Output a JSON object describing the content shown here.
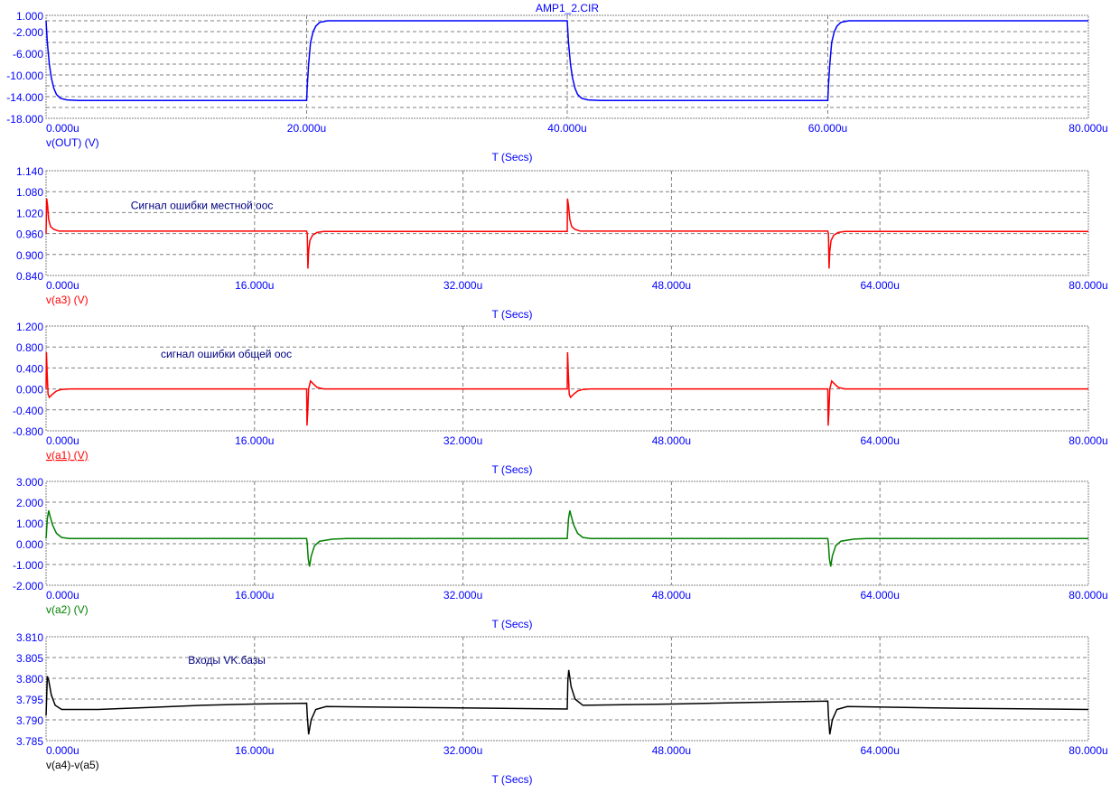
{
  "title": "AMP1_2.CIR",
  "title_color": "#0000ff",
  "axis_label_color": "#0000ff",
  "chart_data": [
    {
      "type": "line",
      "series_name": "v(OUT) (V)",
      "color": "#0000ff",
      "xlabel": "T (Secs)",
      "xlim": [
        0,
        80
      ],
      "x_ticks": [
        0,
        20,
        40,
        60,
        80
      ],
      "x_tick_labels": [
        "0.000u",
        "20.000u",
        "40.000u",
        "60.000u",
        "80.000u"
      ],
      "ylim": [
        -18,
        1
      ],
      "y_grid": [
        -16,
        -14,
        -12,
        -10,
        -8,
        -6,
        -4,
        -2,
        0
      ],
      "y_tick_values": [
        1,
        -2,
        -6,
        -10,
        -14,
        -18
      ],
      "y_tick_labels": [
        "1.000",
        "-2.000",
        "-6.000",
        "-10.000",
        "-14.000",
        "-18.000"
      ],
      "annotation": "",
      "points": [
        [
          0,
          0
        ],
        [
          0.1,
          -4
        ],
        [
          0.25,
          -8
        ],
        [
          0.4,
          -10.5
        ],
        [
          0.6,
          -12.5
        ],
        [
          0.8,
          -13.6
        ],
        [
          1.1,
          -14.3
        ],
        [
          1.6,
          -14.6
        ],
        [
          2.5,
          -14.7
        ],
        [
          20,
          -14.7
        ],
        [
          20.05,
          -12
        ],
        [
          20.15,
          -8
        ],
        [
          20.3,
          -4
        ],
        [
          20.5,
          -2
        ],
        [
          20.7,
          -1
        ],
        [
          21,
          -0.3
        ],
        [
          21.6,
          0
        ],
        [
          40,
          0
        ],
        [
          40.1,
          -4
        ],
        [
          40.25,
          -8
        ],
        [
          40.4,
          -10.5
        ],
        [
          40.6,
          -12.5
        ],
        [
          40.8,
          -13.6
        ],
        [
          41.1,
          -14.3
        ],
        [
          41.6,
          -14.6
        ],
        [
          42.5,
          -14.7
        ],
        [
          60,
          -14.7
        ],
        [
          60.05,
          -12
        ],
        [
          60.15,
          -8
        ],
        [
          60.3,
          -4
        ],
        [
          60.5,
          -2
        ],
        [
          60.7,
          -1
        ],
        [
          61,
          -0.3
        ],
        [
          61.6,
          0
        ],
        [
          80,
          0
        ]
      ]
    },
    {
      "type": "line",
      "series_name": "v(a3) (V)",
      "color": "#ff0000",
      "xlabel": "T (Secs)",
      "xlim": [
        0,
        80
      ],
      "x_ticks": [
        0,
        16,
        32,
        48,
        64,
        80
      ],
      "x_tick_labels": [
        "0.000u",
        "16.000u",
        "32.000u",
        "48.000u",
        "64.000u",
        "80.000u"
      ],
      "ylim": [
        0.84,
        1.14
      ],
      "y_grid": [
        0.9,
        0.96,
        1.02,
        1.08
      ],
      "y_tick_values": [
        1.14,
        1.08,
        1.02,
        0.96,
        0.9,
        0.84
      ],
      "y_tick_labels": [
        "1.140",
        "1.080",
        "1.020",
        "0.960",
        "0.900",
        "0.840"
      ],
      "annotation": "Сигнал ошибки местной оос",
      "annotation_at": [
        6.5,
        1.03
      ],
      "points": [
        [
          0,
          0.96
        ],
        [
          0.05,
          1.06
        ],
        [
          0.12,
          1.04
        ],
        [
          0.2,
          1.0
        ],
        [
          0.35,
          0.98
        ],
        [
          0.6,
          0.972
        ],
        [
          1,
          0.967
        ],
        [
          20,
          0.967
        ],
        [
          20.05,
          0.96
        ],
        [
          20.1,
          0.86
        ],
        [
          20.15,
          0.91
        ],
        [
          20.25,
          0.94
        ],
        [
          20.45,
          0.955
        ],
        [
          20.8,
          0.963
        ],
        [
          21.3,
          0.966
        ],
        [
          40,
          0.966
        ],
        [
          40.02,
          1.06
        ],
        [
          40.1,
          1.04
        ],
        [
          40.2,
          1.0
        ],
        [
          40.35,
          0.98
        ],
        [
          40.6,
          0.972
        ],
        [
          41,
          0.967
        ],
        [
          60,
          0.967
        ],
        [
          60.05,
          0.96
        ],
        [
          60.1,
          0.86
        ],
        [
          60.15,
          0.91
        ],
        [
          60.25,
          0.94
        ],
        [
          60.45,
          0.955
        ],
        [
          60.8,
          0.963
        ],
        [
          61.3,
          0.966
        ],
        [
          80,
          0.966
        ]
      ]
    },
    {
      "type": "line",
      "series_name": "v(a1) (V)",
      "color": "#ff0000",
      "xlabel": "T (Secs)",
      "xlim": [
        0,
        80
      ],
      "x_ticks": [
        0,
        16,
        32,
        48,
        64,
        80
      ],
      "x_tick_labels": [
        "0.000u",
        "16.000u",
        "32.000u",
        "48.000u",
        "64.000u",
        "80.000u"
      ],
      "ylim": [
        -0.8,
        1.2
      ],
      "y_grid": [
        -0.4,
        0,
        0.4,
        0.8
      ],
      "y_tick_values": [
        1.2,
        0.8,
        0.4,
        0,
        -0.4,
        -0.8
      ],
      "y_tick_labels": [
        "1.200",
        "0.800",
        "0.400",
        "0.000",
        "-0.400",
        "-0.800"
      ],
      "annotation": "сигнал ошибки общей оос",
      "annotation_at": [
        8.8,
        0.6
      ],
      "points": [
        [
          0,
          0
        ],
        [
          0.03,
          0.7
        ],
        [
          0.08,
          0.3
        ],
        [
          0.15,
          -0.1
        ],
        [
          0.25,
          -0.16
        ],
        [
          0.5,
          -0.1
        ],
        [
          0.8,
          -0.04
        ],
        [
          1.2,
          -0.01
        ],
        [
          1.8,
          0
        ],
        [
          20,
          0
        ],
        [
          20.03,
          -0.7
        ],
        [
          20.08,
          -0.45
        ],
        [
          20.15,
          0
        ],
        [
          20.3,
          0.15
        ],
        [
          20.5,
          0.1
        ],
        [
          20.8,
          0.03
        ],
        [
          21.3,
          0
        ],
        [
          40,
          0
        ],
        [
          40.03,
          0.7
        ],
        [
          40.08,
          0.3
        ],
        [
          40.15,
          -0.1
        ],
        [
          40.25,
          -0.16
        ],
        [
          40.5,
          -0.1
        ],
        [
          40.8,
          -0.04
        ],
        [
          41.2,
          -0.01
        ],
        [
          41.8,
          0
        ],
        [
          60,
          0
        ],
        [
          60.03,
          -0.7
        ],
        [
          60.08,
          -0.45
        ],
        [
          60.15,
          0
        ],
        [
          60.3,
          0.15
        ],
        [
          60.5,
          0.1
        ],
        [
          60.8,
          0.03
        ],
        [
          61.3,
          0
        ],
        [
          80,
          0
        ]
      ]
    },
    {
      "type": "line",
      "series_name": "v(a2) (V)",
      "color": "#008000",
      "xlabel": "T (Secs)",
      "xlim": [
        0,
        80
      ],
      "x_ticks": [
        0,
        16,
        32,
        48,
        64,
        80
      ],
      "x_tick_labels": [
        "0.000u",
        "16.000u",
        "32.000u",
        "48.000u",
        "64.000u",
        "80.000u"
      ],
      "ylim": [
        -2,
        3
      ],
      "y_grid": [
        -1,
        0,
        1,
        2
      ],
      "y_tick_values": [
        3,
        2,
        1,
        0,
        -1,
        -2
      ],
      "y_tick_labels": [
        "3.000",
        "2.000",
        "1.000",
        "0.000",
        "-1.000",
        "-2.000"
      ],
      "annotation": "",
      "points": [
        [
          0,
          0.25
        ],
        [
          0.1,
          1.2
        ],
        [
          0.2,
          1.6
        ],
        [
          0.3,
          1.35
        ],
        [
          0.5,
          0.9
        ],
        [
          0.8,
          0.5
        ],
        [
          1.2,
          0.3
        ],
        [
          1.8,
          0.25
        ],
        [
          20,
          0.25
        ],
        [
          20.05,
          0
        ],
        [
          20.12,
          -0.7
        ],
        [
          20.22,
          -1.1
        ],
        [
          20.35,
          -0.6
        ],
        [
          20.6,
          -0.1
        ],
        [
          21,
          0.12
        ],
        [
          22,
          0.22
        ],
        [
          23,
          0.25
        ],
        [
          40,
          0.25
        ],
        [
          40.1,
          1.2
        ],
        [
          40.2,
          1.6
        ],
        [
          40.3,
          1.35
        ],
        [
          40.5,
          0.9
        ],
        [
          40.8,
          0.5
        ],
        [
          41.2,
          0.3
        ],
        [
          41.8,
          0.25
        ],
        [
          60,
          0.25
        ],
        [
          60.05,
          0
        ],
        [
          60.12,
          -0.7
        ],
        [
          60.22,
          -1.1
        ],
        [
          60.35,
          -0.6
        ],
        [
          60.6,
          -0.1
        ],
        [
          61,
          0.12
        ],
        [
          62,
          0.22
        ],
        [
          63,
          0.25
        ],
        [
          80,
          0.25
        ]
      ]
    },
    {
      "type": "line",
      "series_name": "v(a4)-v(a5)",
      "color": "#000000",
      "xlabel": "T (Secs)",
      "xlim": [
        0,
        80
      ],
      "x_ticks": [
        0,
        16,
        32,
        48,
        64,
        80
      ],
      "x_tick_labels": [
        "0.000u",
        "16.000u",
        "32.000u",
        "48.000u",
        "64.000u",
        "80.000u"
      ],
      "ylim": [
        3.785,
        3.81
      ],
      "y_grid": [
        3.79,
        3.795,
        3.8,
        3.805
      ],
      "y_tick_values": [
        3.81,
        3.805,
        3.8,
        3.795,
        3.79,
        3.785
      ],
      "y_tick_labels": [
        "3.810",
        "3.805",
        "3.800",
        "3.795",
        "3.790",
        "3.785"
      ],
      "annotation": "Входы VK.базы",
      "annotation_at": [
        10.9,
        3.8035
      ],
      "points": [
        [
          0,
          3.791
        ],
        [
          0.1,
          3.8005
        ],
        [
          0.2,
          3.7995
        ],
        [
          0.4,
          3.796
        ],
        [
          0.7,
          3.7935
        ],
        [
          1.2,
          3.7925
        ],
        [
          4,
          3.7925
        ],
        [
          8,
          3.793
        ],
        [
          12,
          3.7935
        ],
        [
          16,
          3.7938
        ],
        [
          20,
          3.794
        ],
        [
          20.05,
          3.791
        ],
        [
          20.15,
          3.7865
        ],
        [
          20.35,
          3.79
        ],
        [
          20.7,
          3.7925
        ],
        [
          21.5,
          3.7932
        ],
        [
          28,
          3.793
        ],
        [
          40,
          3.7926
        ],
        [
          40.05,
          3.7995
        ],
        [
          40.12,
          3.802
        ],
        [
          40.3,
          3.798
        ],
        [
          40.6,
          3.795
        ],
        [
          41.2,
          3.7935
        ],
        [
          48,
          3.7938
        ],
        [
          54,
          3.7942
        ],
        [
          60,
          3.7945
        ],
        [
          60.05,
          3.791
        ],
        [
          60.15,
          3.7865
        ],
        [
          60.35,
          3.79
        ],
        [
          60.7,
          3.7925
        ],
        [
          61.5,
          3.7932
        ],
        [
          70,
          3.7928
        ],
        [
          80,
          3.7925
        ]
      ]
    }
  ]
}
